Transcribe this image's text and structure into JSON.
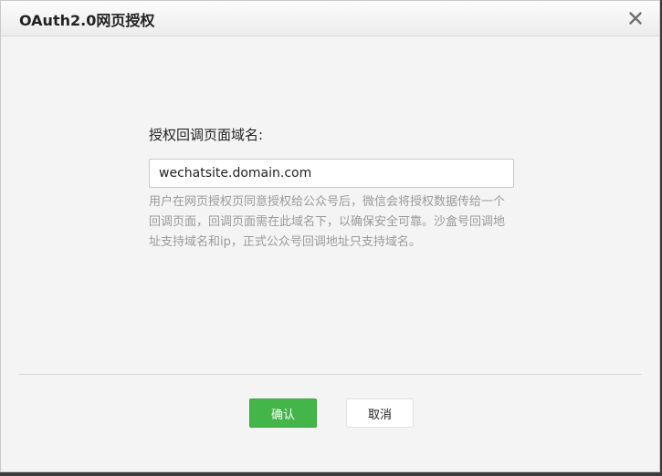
{
  "dialog": {
    "title": "OAuth2.0网页授权"
  },
  "form": {
    "label": "授权回调页面域名:",
    "input_value": "wechatsite.domain.com",
    "hint": "用户在网页授权页同意授权给公众号后，微信会将授权数据传给一个回调页面，回调页面需在此域名下，以确保安全可靠。沙盒号回调地址支持域名和ip，正式公众号回调地址只支持域名。"
  },
  "buttons": {
    "confirm_label": "确认",
    "cancel_label": "取消"
  },
  "icons": {
    "close": "close-icon"
  },
  "colors": {
    "primary_button": "#44b549",
    "hint_text": "#9a9a9a"
  }
}
